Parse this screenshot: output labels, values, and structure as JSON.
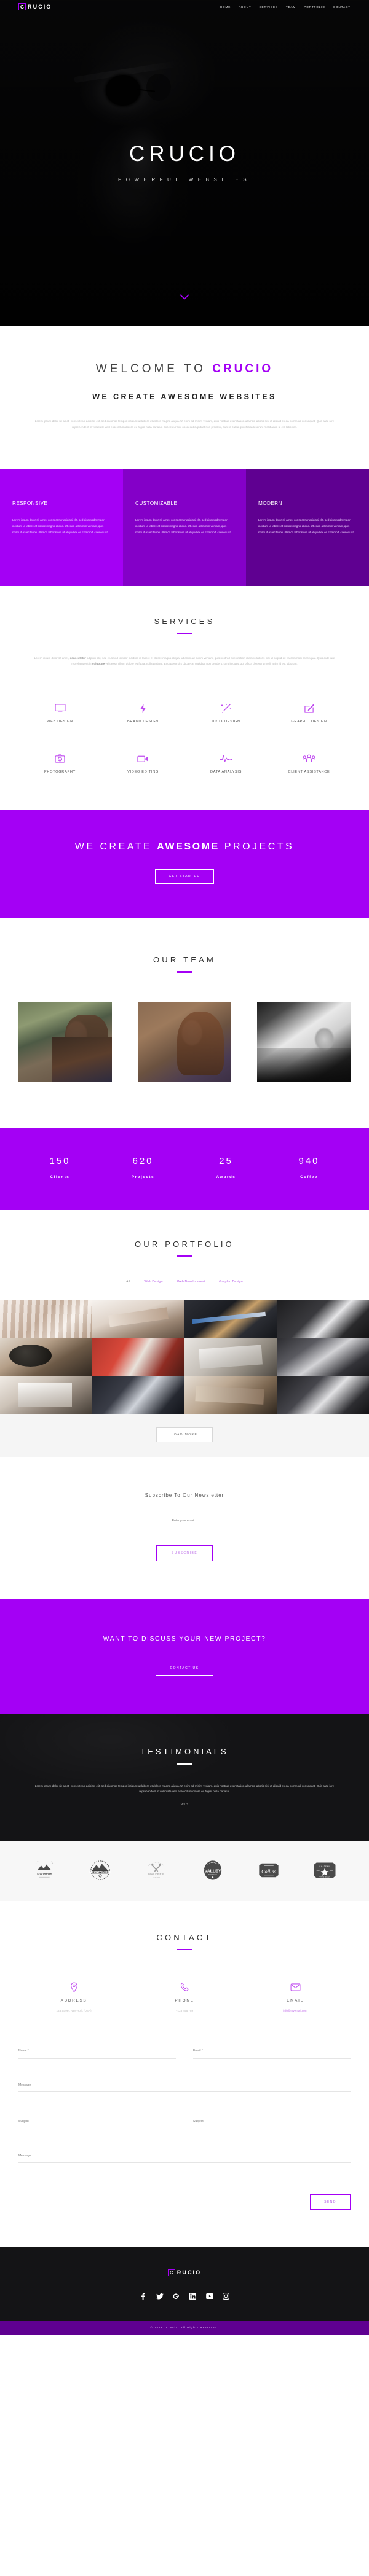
{
  "brand": {
    "mark": "C",
    "name": "RUCIO",
    "full": "CRUCIO"
  },
  "nav": {
    "items": [
      {
        "label": "HOME"
      },
      {
        "label": "ABOUT"
      },
      {
        "label": "SERVICES"
      },
      {
        "label": "TEAM"
      },
      {
        "label": "PORTFOLIO"
      },
      {
        "label": "CONTACT"
      }
    ]
  },
  "hero": {
    "title": "CRUCIO",
    "subtitle": "POWERFUL WEBSITES",
    "scroll_icon": "chevron-down-icon"
  },
  "welcome": {
    "heading_prefix": "WELCOME TO ",
    "heading_accent": "CRUCIO",
    "subheading": "WE CREATE AWESOME WEBSITES",
    "paragraph": "Lorem ipsum dolor sit amet, consectetur adipisci elit, sed eiusmod tempor incidunt ut labore et dolore magna aliqua. Ut enim ad minim veniam, quis nostrud exercitation ullamco laboris nisi ut aliquid ex ea commodi consequat. Quis aute iure reprehenderit in voluptate velit esse cillum dolore eu fugiat nulla pariatur. Excepteur sint obcaecat cupiditat non proident, sunt in culpa qui officia deserunt mollit anim id est laborum."
  },
  "features": [
    {
      "title": "RESPONSIVE",
      "text": "Lorem ipsum dolor sit amet, consectetur adipisci elit, sed eiusmod tempor incidunt ut labore et dolore magna aliqua. Ut enim ad minim veniam, quis nostrud exercitation ullamco laboris nisi ut aliquid ex ea commodi consequat.",
      "color": "#a400f5"
    },
    {
      "title": "CUSTOMIZABLE",
      "text": "Lorem ipsum dolor sit amet, consectetur adipisci elit, sed eiusmod tempor incidunt ut labore et dolore magna aliqua. Ut enim ad minim veniam, quis nostrud exercitation ullamco laboris nisi ut aliquid ex ea commodi consequat.",
      "color": "#8400c8"
    },
    {
      "title": "MODERN",
      "text": "Lorem ipsum dolor sit amet, consectetur adipisci elit, sed eiusmod tempor incidunt ut labore et dolore magna aliqua. Ut enim ad minim veniam, quis nostrud exercitation ullamco laboris nisi ut aliquid ex ea commodi consequat.",
      "color": "#5f0091"
    }
  ],
  "services": {
    "title": "SERVICES",
    "paragraph_a": "Lorem ipsum dolor sit amet, ",
    "paragraph_bold_1": "consectetur",
    "paragraph_b": " adipisci elit, sed eiusmod tempor incidunt ut labore et dolore magna aliqua. Ut enim ad minim veniam, quis nostrud exercitation ullamco laboris nisi ut aliquid ex ea commodi consequat. Quis aute iure reprehenderit in ",
    "paragraph_bold_2": "voluptate",
    "paragraph_c": " velit esse cillum dolore eu fugiat nulla pariatur. Excepteur sint obcaecat cupiditat non proident, sunt in culpa qui officia deserunt mollit anim id est laborum.",
    "items": [
      {
        "label": "WEB DESIGN",
        "icon": "monitor-icon"
      },
      {
        "label": "BRAND DESIGN",
        "icon": "lightning-bolt-icon"
      },
      {
        "label": "UI/UX DESIGN",
        "icon": "magic-wand-icon"
      },
      {
        "label": "GRAPHIC DESIGN",
        "icon": "pen-square-icon"
      },
      {
        "label": "PHOTOGRAPHY",
        "icon": "camera-icon"
      },
      {
        "label": "VIDEO EDITING",
        "icon": "video-camera-icon"
      },
      {
        "label": "DATA ANALYSIS",
        "icon": "pulse-chart-icon"
      },
      {
        "label": "CLIENT ASSISTANCE",
        "icon": "group-people-icon"
      }
    ]
  },
  "cta": {
    "heading_a": "WE CREATE ",
    "heading_bold": "AWESOME",
    "heading_b": " PROJECTS",
    "button": "GET STARTED"
  },
  "team": {
    "title": "OUR TEAM",
    "members": [
      {
        "name": "team-photo-1"
      },
      {
        "name": "team-photo-2"
      },
      {
        "name": "team-photo-3"
      }
    ]
  },
  "stats": [
    {
      "value": "150",
      "label": "Clients"
    },
    {
      "value": "620",
      "label": "Projects"
    },
    {
      "value": "25",
      "label": "Awards"
    },
    {
      "value": "940",
      "label": "Coffee"
    }
  ],
  "portfolio": {
    "title": "OUR PORTFOLIO",
    "filters": [
      {
        "label": "All",
        "active": true
      },
      {
        "label": "Web Design",
        "active": false
      },
      {
        "label": "Web Development",
        "active": false
      },
      {
        "label": "Graphic Design",
        "active": false
      }
    ],
    "load_more": "LOAD MORE"
  },
  "newsletter": {
    "heading": "Subscribe To Our Newsletter",
    "placeholder": "Enter your email...",
    "button": "SUBSCRIBE"
  },
  "cta2": {
    "heading": "WANT TO DISCUSS YOUR NEW PROJECT?",
    "button": "CONTACT US"
  },
  "testimonials": {
    "title": "TESTIMONIALS",
    "quote": "Lorem ipsum dolor sit amet, consectetur adipisci elit, sed eiusmod tempor incidunt ut labore et dolore magna aliqua. Ut enim ad minim veniam, quis nostrud exercitation ullamco laboris nisi ut aliquid ex ea commodi consequat. Quis aute iure reprehenderit in voluptate velit esse cillum dolore eu fugiat nulla pariatur.",
    "author": "- Jim P. -"
  },
  "clients": [
    {
      "name": "Mountain",
      "icon": "mountain-badge-logo"
    },
    {
      "name": "MOUNTAINBIKE",
      "icon": "mountainbike-badge-logo"
    },
    {
      "name": "WALKERS",
      "icon": "walkers-badge-logo"
    },
    {
      "name": "VALLEY",
      "icon": "valley-badge-logo"
    },
    {
      "name": "Collins",
      "icon": "collins-badge-logo"
    },
    {
      "name": "CHATEAU",
      "icon": "star-badge-logo"
    }
  ],
  "contact": {
    "title": "CONTACT",
    "cards": [
      {
        "icon": "map-pin-icon",
        "heading": "ADDRESS",
        "value": "123 Street, New York (USA)"
      },
      {
        "icon": "phone-icon",
        "heading": "PHONE",
        "value": "+123 456 789"
      },
      {
        "icon": "envelope-icon",
        "heading": "EMAIL",
        "value": "info@myemail.com"
      }
    ],
    "form": {
      "name_placeholder": "Name *",
      "email_placeholder": "Email *",
      "subject_placeholder": "Subject",
      "message_placeholder": "Message",
      "send_button": "SEND"
    }
  },
  "footer": {
    "social": [
      {
        "name": "facebook-icon"
      },
      {
        "name": "twitter-icon"
      },
      {
        "name": "google-plus-icon"
      },
      {
        "name": "linkedin-icon"
      },
      {
        "name": "youtube-icon"
      },
      {
        "name": "instagram-icon"
      }
    ],
    "copyright": "© 2016. Crucio. All Rights Reserved."
  }
}
